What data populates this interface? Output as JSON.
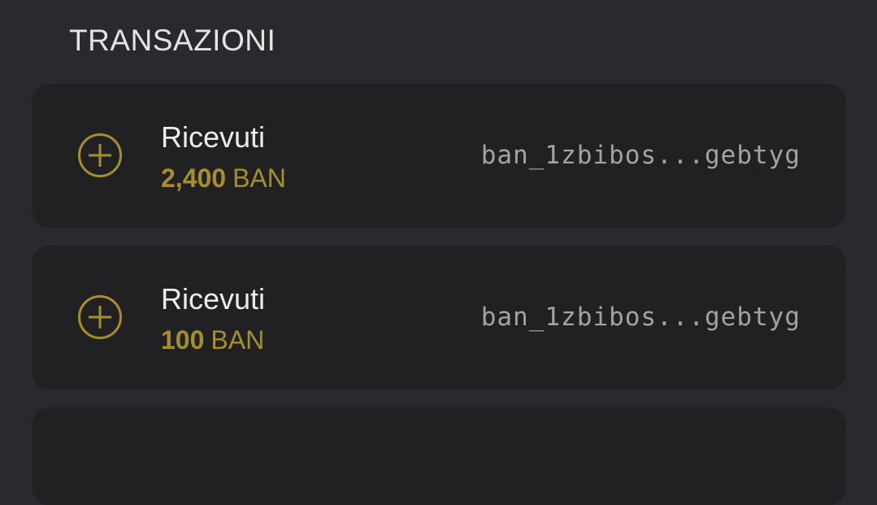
{
  "section": {
    "title": "TRANSAZIONI"
  },
  "colors": {
    "background": "#2a2a2e",
    "card": "#212124",
    "accent": "#a68f2a",
    "text": "#ececec",
    "address": "#a3a3a3"
  },
  "transactions": [
    {
      "icon": "plus-circle-icon",
      "type": "Ricevuti",
      "amount": "2,400",
      "unit": "BAN",
      "address": "ban_1zbibos...gebtyg"
    },
    {
      "icon": "plus-circle-icon",
      "type": "Ricevuti",
      "amount": "100",
      "unit": "BAN",
      "address": "ban_1zbibos...gebtyg"
    }
  ]
}
